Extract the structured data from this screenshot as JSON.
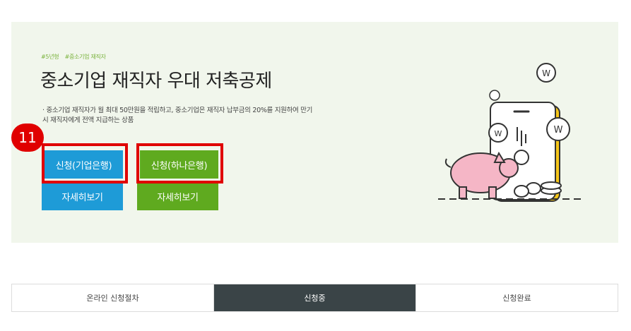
{
  "hero": {
    "tags": [
      "#5년형",
      "#중소기업 재직자"
    ],
    "title": "중소기업 재직자 우대 저축공제",
    "description_line1": "· 중소기업 재직자가 월 최대 50만원을 적립하고, 중소기업은 재직자 납부금의 20%를 지원하여 만기",
    "description_line2": "시 재직자에게 전액 지급하는 상품",
    "apply_ibk_label": "신청(기업은행)",
    "apply_hana_label": "신청(하나은행)",
    "detail_ibk_label": "자세히보기",
    "detail_hana_label": "자세히보기",
    "step_badge": "11"
  },
  "tabs": [
    {
      "label": "온라인 신청절차",
      "active": false
    },
    {
      "label": "신청중",
      "active": true
    },
    {
      "label": "신청완료",
      "active": false
    }
  ],
  "colors": {
    "hero_bg": "#f1f6ec",
    "ibk_blue": "#1e9bd7",
    "hana_green": "#5faa1f",
    "highlight_red": "#e00000",
    "active_tab": "#3a4447"
  },
  "icons": [
    "piggy-bank-illustration",
    "coin-icon",
    "phone-illustration"
  ]
}
